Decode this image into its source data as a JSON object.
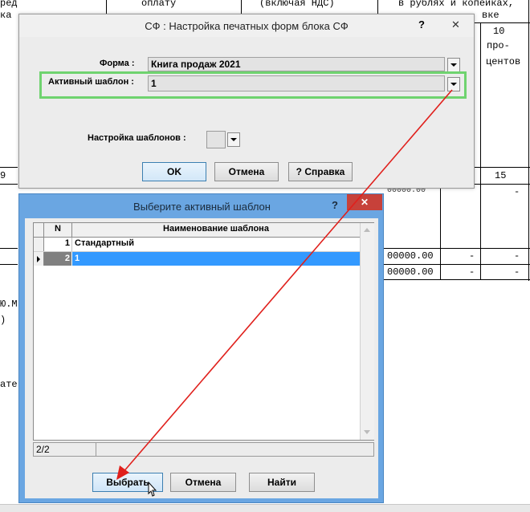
{
  "background_doc": {
    "top_text_1": "ред",
    "top_text_2": "оплату",
    "top_text_3": "(включая НДС)",
    "top_text_4": "в рублях и копейках,",
    "row_ka": "ка",
    "row_vke": "вке",
    "col10_line1": "10",
    "col10_line2": "про-",
    "col10_line3": "центов",
    "num_9": "9",
    "num_15": "15",
    "dash_1": "-",
    "amount_1": "00000.00",
    "dash_2": "-",
    "dash_3": "-",
    "amount_2": "00000.00",
    "dash_4": "-",
    "dash_5": "-",
    "amount_partial": "00000.00",
    "side_1": "Ю.М.",
    "side_2": ")",
    "side_3": "ате"
  },
  "settings_dialog": {
    "title": "СФ : Настройка печатных форм блока СФ",
    "help_glyph": "?",
    "close_glyph": "✕",
    "form_label": "Форма :",
    "form_value": "Книга продаж 2021",
    "template_label": "Активный шаблон :",
    "template_value": "1",
    "templates_setup_label": "Настройка шаблонов :",
    "ok_label": "OK",
    "cancel_label": "Отмена",
    "help_label": "? Справка"
  },
  "chooser_dialog": {
    "title": "Выберите активный шаблон",
    "help_glyph": "?",
    "close_glyph": "✕",
    "columns": [
      "N",
      "Наименование шаблона"
    ],
    "rows": [
      {
        "n": "1",
        "name": "Стандартный",
        "selected": false
      },
      {
        "n": "2",
        "name": "1",
        "selected": true
      }
    ],
    "status": "2/2",
    "select_label": "Выбрать",
    "cancel_label": "Отмена",
    "find_label": "Найти"
  },
  "colors": {
    "highlight_green": "#6fd36f",
    "arrow_red": "#e0201c",
    "selection_blue": "#3399ff",
    "window_frame": "#6aa6e2"
  }
}
